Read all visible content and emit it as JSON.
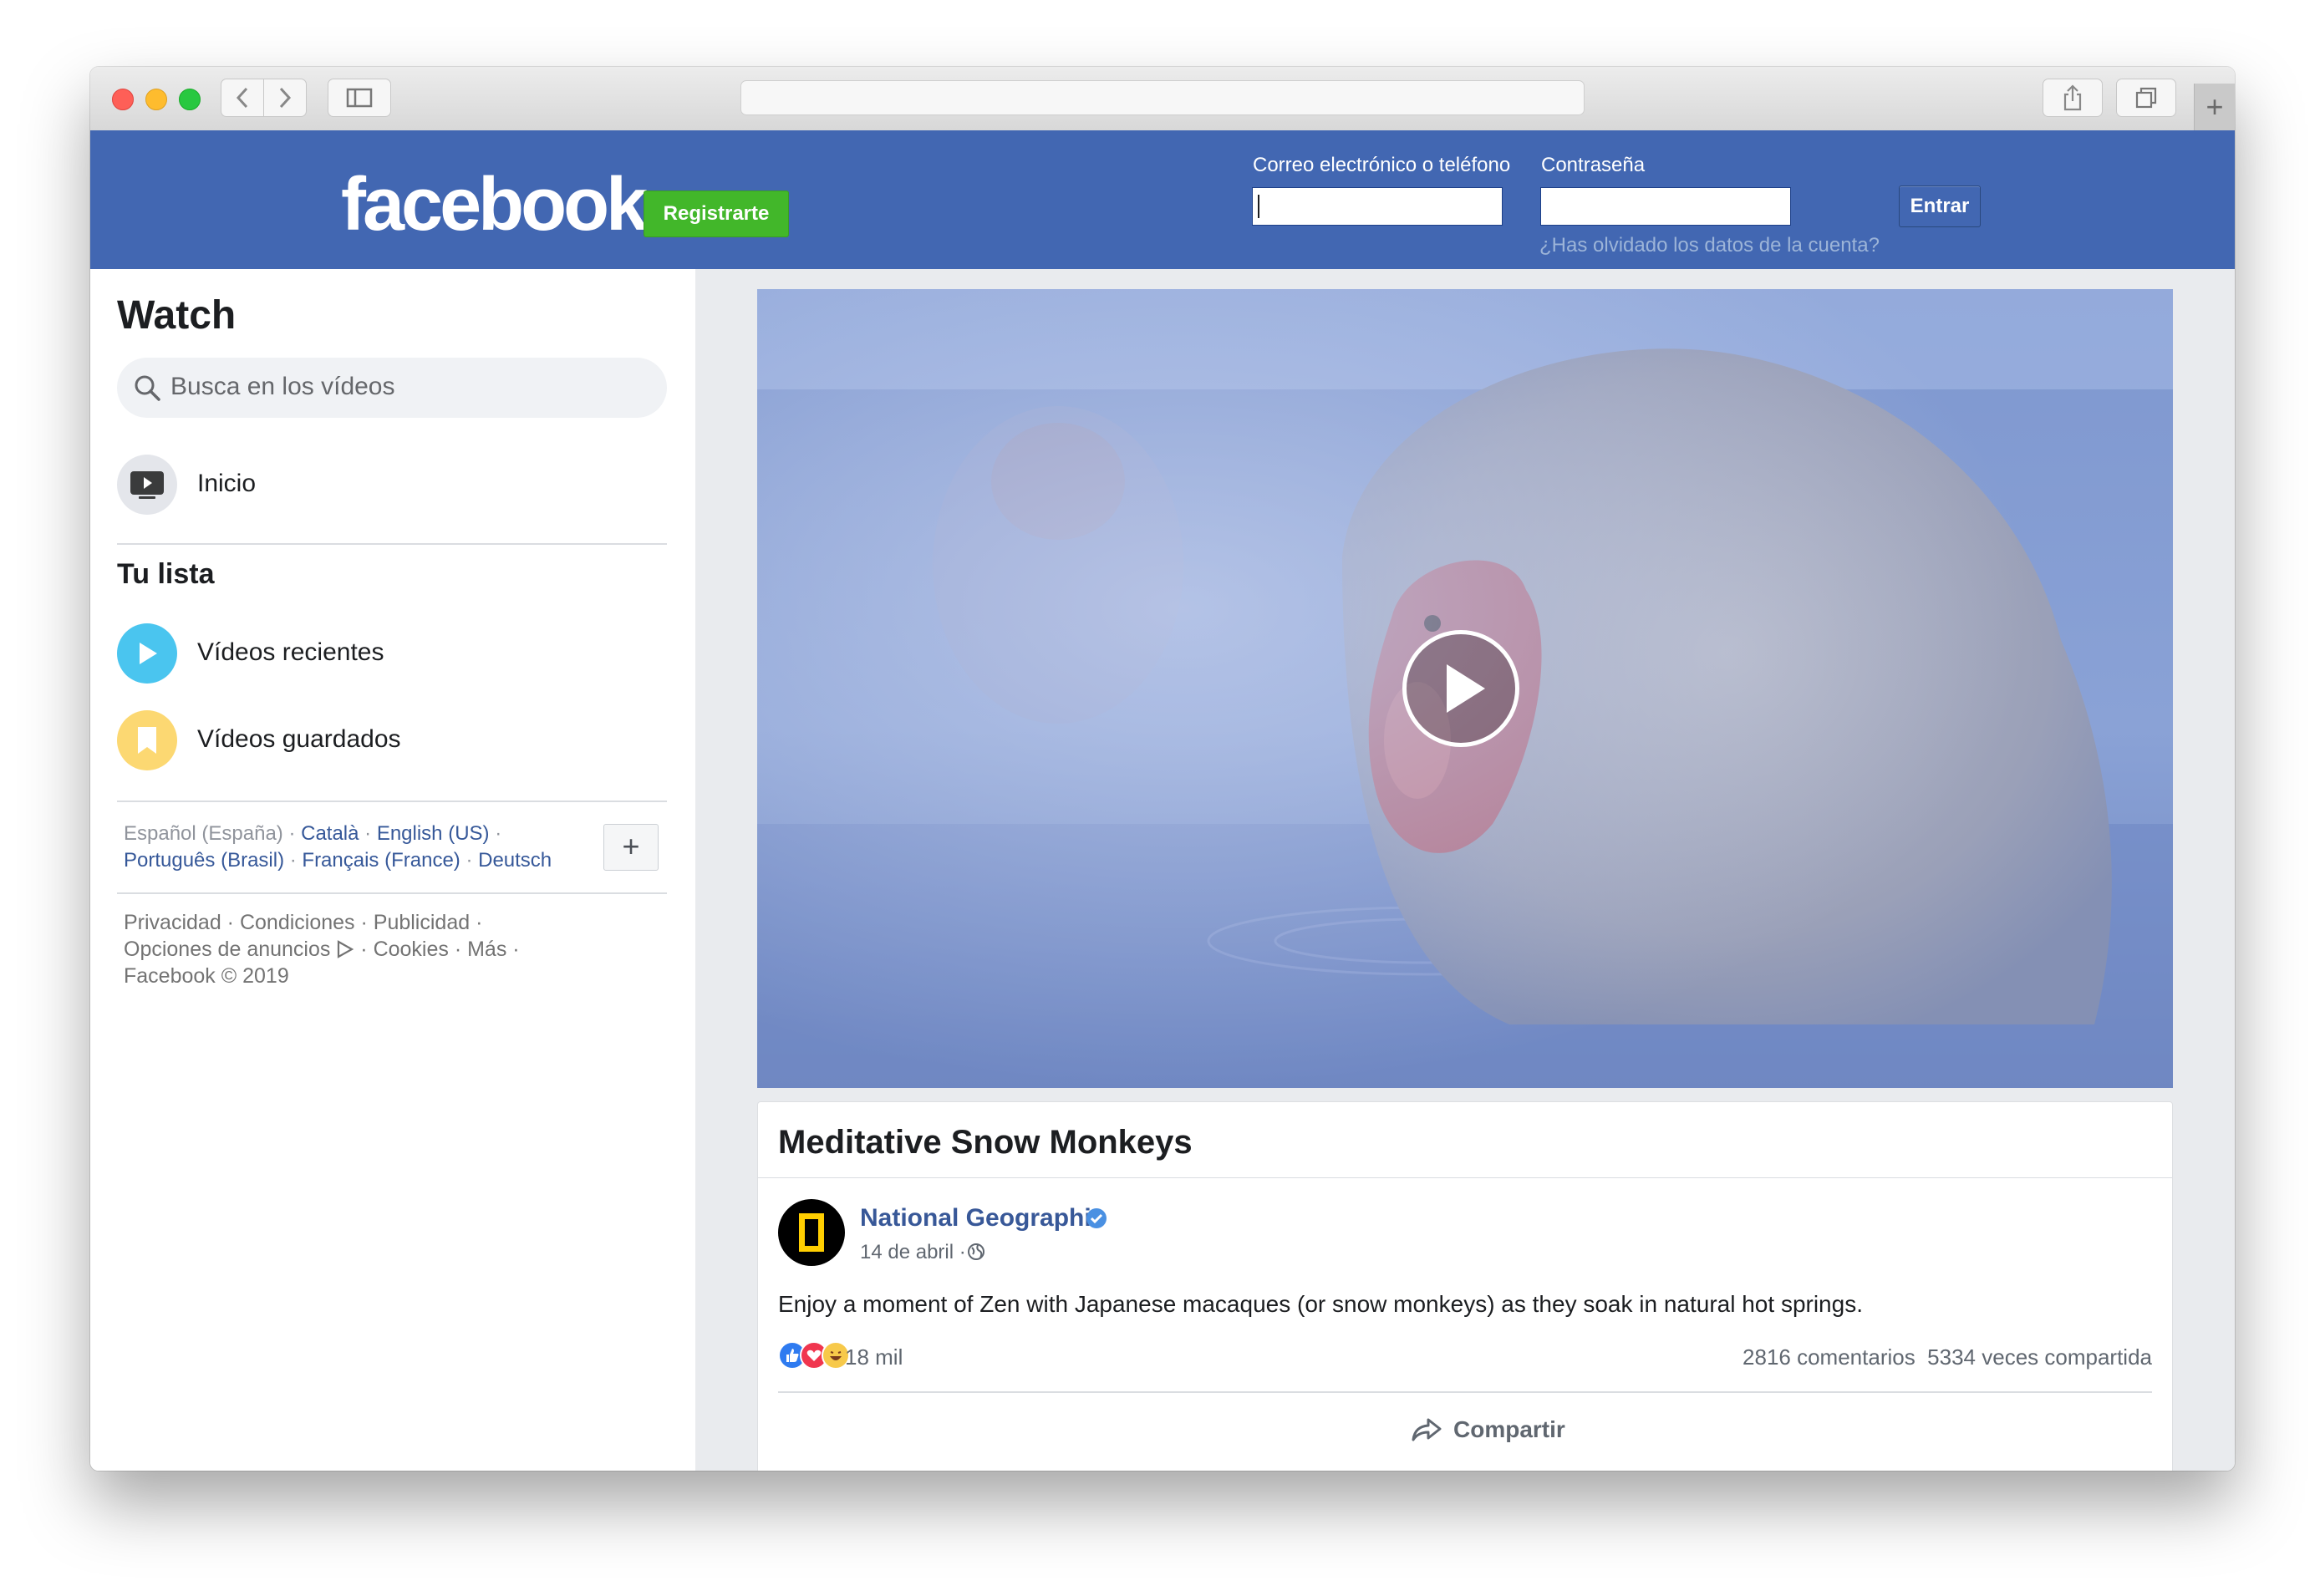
{
  "header": {
    "logo": "facebook",
    "signup_label": "Registrarte",
    "email_label": "Correo electrónico o teléfono",
    "password_label": "Contraseña",
    "login_label": "Entrar",
    "forgot_link": "¿Has olvidado los datos de la cuenta?"
  },
  "sidebar": {
    "title": "Watch",
    "search_placeholder": "Busca en los vídeos",
    "nav_home": {
      "label": "Inicio",
      "icon": "tv-icon"
    },
    "list_title": "Tu lista",
    "list_items": [
      {
        "label": "Vídeos recientes",
        "icon": "play-icon",
        "color": "#4ac5ef"
      },
      {
        "label": "Vídeos guardados",
        "icon": "bookmark-icon",
        "color": "#fcd872"
      }
    ],
    "languages": {
      "current": "Español (España)",
      "others": [
        "Català",
        "English (US)",
        "Português (Brasil)",
        "Français (France)",
        "Deutsch"
      ],
      "add_label": "+"
    },
    "footer": {
      "privacy": "Privacidad",
      "terms": "Condiciones",
      "ads": "Publicidad",
      "ad_choices": "Opciones de anuncios",
      "cookies": "Cookies",
      "more": "Más",
      "copyright": "Facebook © 2019"
    }
  },
  "video": {
    "title": "Meditative Snow Monkeys",
    "page_name": "National Geographic",
    "date": "14 de abril",
    "description": "Enjoy a moment of Zen with Japanese macaques (or snow monkeys) as they soak in natural hot springs.",
    "reactions_count": "18 mil",
    "comments": "2816 comentarios",
    "shares": "5334 veces compartida",
    "share_label": "Compartir"
  },
  "colors": {
    "fb_blue": "#4267b2",
    "signup_green": "#42b72a",
    "link_blue": "#385898"
  }
}
